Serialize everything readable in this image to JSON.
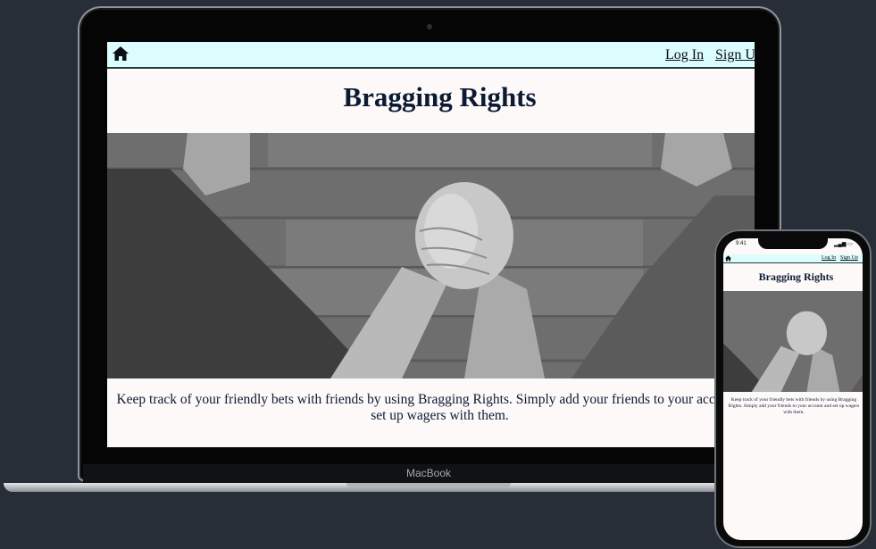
{
  "nav": {
    "home_icon": "home-icon",
    "login_label": "Log In",
    "signup_label": "Sign Up"
  },
  "hero": {
    "title": "Bragging Rights",
    "image_icon": "arm-wrestling-photo"
  },
  "description": "Keep track of your friendly bets with friends by using Bragging Rights. Simply add your friends to your account and set up wagers with them.",
  "device": {
    "laptop_label": "MacBook",
    "phone_time": "9:41"
  },
  "colors": {
    "navbar_bg": "#dcfdfd",
    "page_bg": "#fdf9f9",
    "title_color": "#0b1a33",
    "backdrop": "#282e38"
  }
}
